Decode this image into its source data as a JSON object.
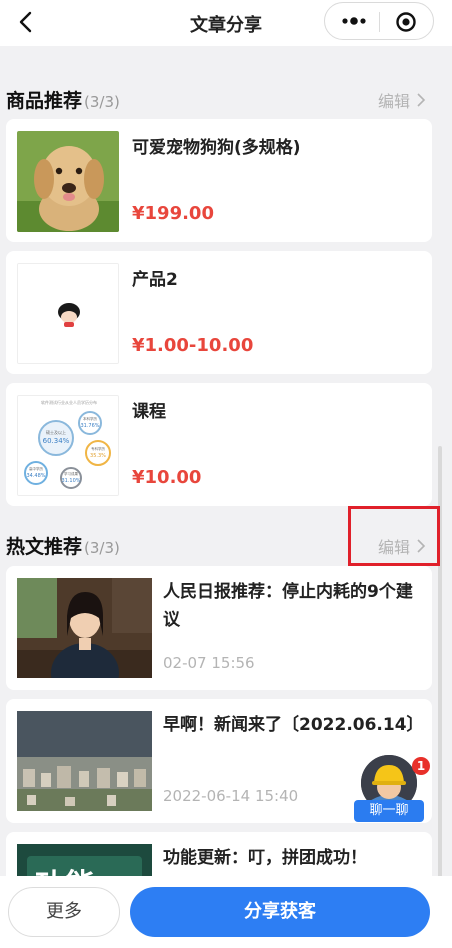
{
  "header": {
    "title": "文章分享",
    "back_icon": "chevron-left-icon",
    "more_icon": "more-dots-icon",
    "close_icon": "target-circle-icon"
  },
  "products_section": {
    "title": "商品推荐",
    "count": "(3/3)",
    "edit_label": "编辑",
    "items": [
      {
        "name": "可爱宠物狗狗(多规格)",
        "price": "¥199.00",
        "image": "puppy-photo"
      },
      {
        "name": "产品2",
        "price": "¥1.00-10.00",
        "image": "cartoon-girl-icon"
      },
      {
        "name": "课程",
        "price": "¥10.00",
        "image": "infographic-chart"
      }
    ],
    "course_chart": {
      "heading": "软件测试行业从业人员学历分布",
      "labels": [
        "硕士及以上",
        "本科学历",
        "专科学历",
        "高中学历",
        "学习成果"
      ],
      "values": [
        "60.34%",
        "31.76%",
        "35.3%",
        "34.48%",
        "31.10%"
      ]
    }
  },
  "articles_section": {
    "title": "热文推荐",
    "count": "(3/3)",
    "edit_label": "编辑",
    "items": [
      {
        "title": "人民日报推荐：停止内耗的9个建议",
        "date": "02-07 15:56",
        "image": "woman-photo"
      },
      {
        "title": "早啊！新闻来了〔2022.06.14〕",
        "date": "2022-06-14 15:40",
        "image": "city-photo"
      },
      {
        "title": "功能更新：叮，拼团成功！",
        "date": "",
        "image": "feature-banner",
        "image_text": "功能"
      }
    ]
  },
  "chat_widget": {
    "label": "聊一聊",
    "badge": "1",
    "icon": "worker-avatar-icon"
  },
  "bottom_bar": {
    "more_label": "更多",
    "share_label": "分享获客"
  },
  "colors": {
    "accent": "#2d7ef3",
    "price": "#e8463c",
    "highlight": "#e0202a"
  }
}
